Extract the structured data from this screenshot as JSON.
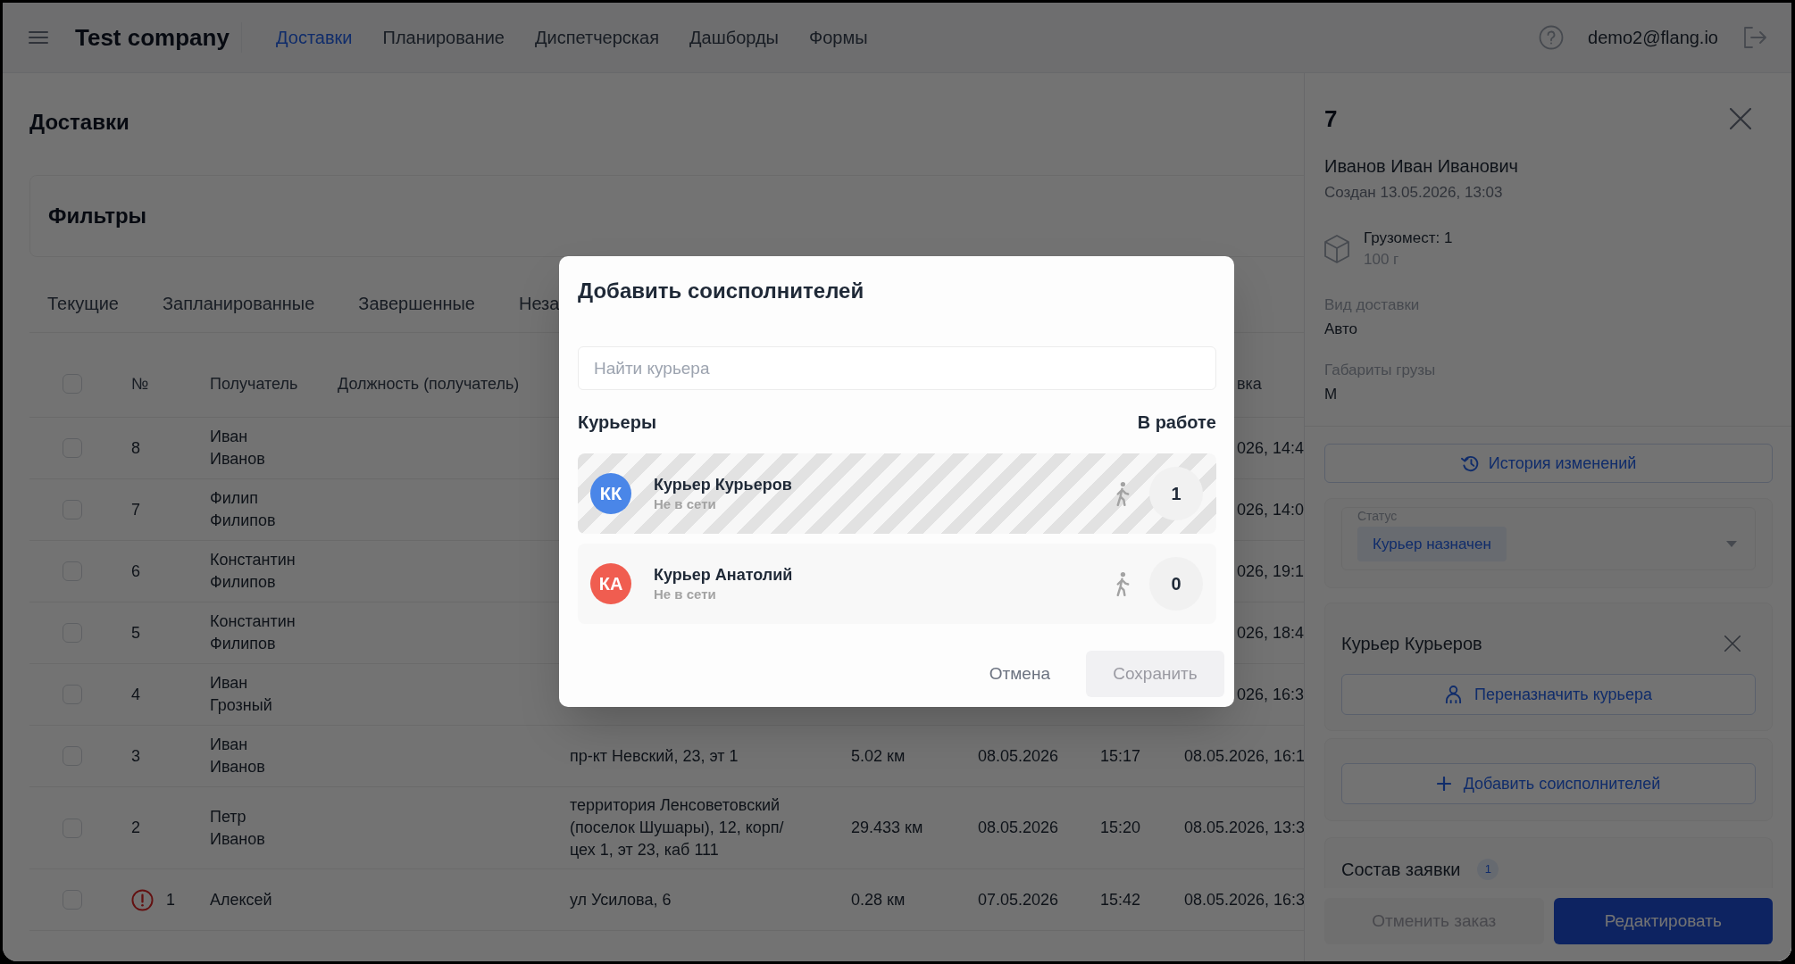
{
  "top_bar": {
    "brand": "Test company",
    "nav": [
      {
        "label": "Доставки",
        "selected": true
      },
      {
        "label": "Планирование",
        "selected": false
      },
      {
        "label": "Диспетчерская",
        "selected": false
      },
      {
        "label": "Дашборды",
        "selected": false
      },
      {
        "label": "Формы",
        "selected": false
      }
    ],
    "user_email": "demo2@flang.io"
  },
  "page": {
    "title": "Доставки",
    "filters": {
      "title": "Фильтры"
    },
    "tabs": [
      {
        "label": "Текущие",
        "selected": false
      },
      {
        "label": "Запланированные",
        "selected": false
      },
      {
        "label": "Завершенные",
        "selected": false
      },
      {
        "label": "Неза",
        "selected": false
      }
    ]
  },
  "table": {
    "header_checkbox": {
      "checked": false
    },
    "columns": [
      {
        "label": "№"
      },
      {
        "label": "Получатель"
      },
      {
        "label": "Должность (получатель)"
      },
      {
        "label": "вка"
      }
    ],
    "rows": [
      {
        "checked": false,
        "alert": false,
        "number": "8",
        "recipient": "Иван Иванов",
        "column_9": "026, 14:4"
      },
      {
        "checked": false,
        "alert": false,
        "number": "7",
        "recipient": "Филип Филипов",
        "column_9": "026, 14:0"
      },
      {
        "checked": false,
        "alert": false,
        "number": "6",
        "recipient": "Константин Филипов",
        "column_9": "026, 19:1"
      },
      {
        "checked": false,
        "alert": false,
        "number": "5",
        "recipient": "Константин Филипов",
        "column_9": "026, 18:4"
      },
      {
        "checked": false,
        "alert": false,
        "number": "4",
        "recipient": "Иван Грозный",
        "column_9": "026, 16:3"
      },
      {
        "checked": false,
        "alert": false,
        "number": "3",
        "recipient": "Иван Иванов",
        "column_5": "пр-кт Невский, 23, эт 1",
        "column_6": "5.02 км",
        "column_7": "08.05.2026",
        "column_8": "15:17",
        "column_9": "08.05.2026, 16:1"
      },
      {
        "checked": false,
        "alert": false,
        "number": "2",
        "recipient": "Петр Иванов",
        "column_5": "территория Ленсоветовский (поселок Шушары), 12, корп/цех 1, эт 23, каб 111",
        "column_6": "29.433 км",
        "column_7": "08.05.2026",
        "column_8": "15:20",
        "column_9": "08.05.2026, 13:3"
      },
      {
        "checked": false,
        "alert": true,
        "number": "1",
        "recipient": "Алексей",
        "column_5": "ул Усилова, 6",
        "column_6": "0.28 км",
        "column_7": "07.05.2026",
        "column_8": "15:42",
        "column_9": "08.05.2026, 16:3"
      }
    ]
  },
  "order_panel": {
    "number": "7",
    "customer": "Иванов Иван Иванович",
    "created": "Создан 13.05.2026, 13:03",
    "cargo": {
      "title": "Грузомест: 1",
      "weight": "100 г"
    },
    "fields": [
      {
        "label": "Вид доставки",
        "value": "Авто"
      },
      {
        "label": "Габариты грузы",
        "value": "М"
      }
    ],
    "history_button": "История изменений",
    "status": {
      "label": "Статус",
      "value": "Курьер назначен"
    },
    "courier": {
      "name": "Курьер Курьеров",
      "reassign_button": "Переназначить курьера"
    },
    "add_button": "Добавить соисполнителей",
    "composition": {
      "title": "Состав заявки",
      "count": "1"
    },
    "actions": [
      {
        "label": "Отменить заказ",
        "kind": "secondary"
      },
      {
        "label": "Редактировать",
        "kind": "primary"
      }
    ]
  },
  "dialog": {
    "title": "Добавить соисполнителей",
    "search": {
      "placeholder": "Найти курьера"
    },
    "list_heading": "Курьеры",
    "count_heading": "В работе",
    "couriers": [
      {
        "initials": "КК",
        "color": "#4a86e8",
        "name": "Курьер Курьеров",
        "status": "Не в сети",
        "count": "1",
        "disabled": true
      },
      {
        "initials": "КА",
        "color": "#f05d50",
        "name": "Курьер Анатолий",
        "status": "Не в сети",
        "count": "0",
        "disabled": false
      }
    ],
    "buttons": [
      {
        "label": "Отмена",
        "kind": "text",
        "disabled": false
      },
      {
        "label": "Сохранить",
        "kind": "filled",
        "disabled": true
      }
    ]
  }
}
